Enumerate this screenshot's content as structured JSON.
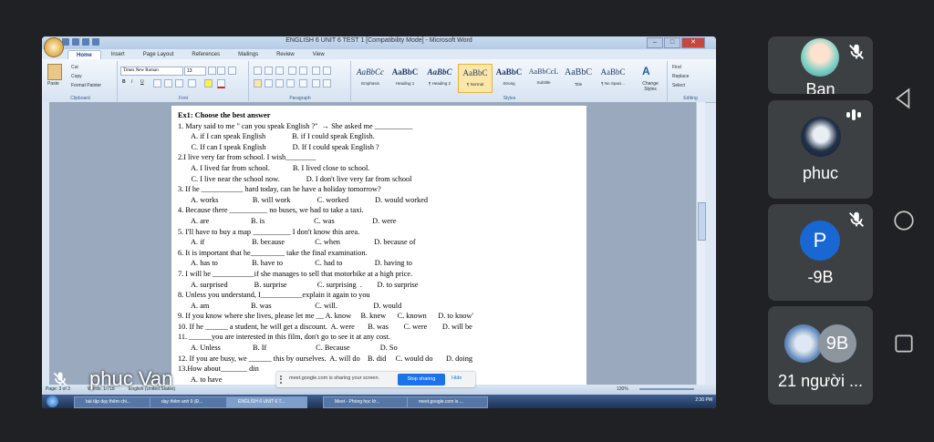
{
  "word": {
    "window_title": "ENGLISH 6 UNIT 6 TEST 1 [Compatibility Mode] - Microsoft Word",
    "tabs": [
      "Home",
      "Insert",
      "Page Layout",
      "References",
      "Mailings",
      "Review",
      "View"
    ],
    "clipboard": {
      "paste": "Paste",
      "cut": "Cut",
      "copy": "Copy",
      "format_painter": "Format Painter",
      "label": "Clipboard"
    },
    "font": {
      "name": "Times New Roman",
      "size": "13",
      "label": "Font"
    },
    "paragraph_label": "Paragraph",
    "styles_label": "Styles",
    "styles": [
      {
        "sample": "AaBbCc",
        "name": "Emphasis"
      },
      {
        "sample": "AaBbC",
        "name": "Heading 1"
      },
      {
        "sample": "AaBbC",
        "name": "¶ Heading 2"
      },
      {
        "sample": "AaBbC",
        "name": "¶ Normal"
      },
      {
        "sample": "AaBbC",
        "name": "Strong"
      },
      {
        "sample": "AaBbCcL",
        "name": "Subtitle"
      },
      {
        "sample": "AaBbC",
        "name": "Title"
      },
      {
        "sample": "AaBbC",
        "name": "¶ No Spaci..."
      }
    ],
    "change_styles": "Change Styles",
    "editing": {
      "find": "Find",
      "replace": "Replace",
      "select": "Select",
      "label": "Editing"
    },
    "document_lines": [
      "Ex1: Choose the best answer",
      "1. Mary said to me \" can you speak English ?\"  → She asked me __________",
      "       A. if I can speak English              B. if I could speak English.",
      "       C. If can I speak English              D. If I could speak English ?",
      "2.I live very far from school. I wish________",
      "       A. I lived far from school.            B. I lived close to school.",
      "       C. I live near the school now.              D. I don't live very far from school",
      "3. If he ___________ hard today, can he have a holiday tomorrow?",
      "       A. works                  B. will work              C. worked              D. would worked",
      "4. Because there __________ no buses, we had to take a taxi.",
      "       A. are                      B. is                          C. was                    D. were",
      "5. I'll have to buy a map __________ I don't know this area.",
      "       A. if                         B. because                C. when                  D. because of",
      "6. It is important that he_________ take the final examination.",
      "       A. has to                  B. have to                 C. had to                 D. having to",
      "7. I will be ___________if she manages to sell that motorbike at a high price.",
      "       A. surprised              B. surprise                C. surprising  .        D. to surprise",
      "8. Unless you understand, I___________explain it again to you",
      "       A. am                      B. was                       C. will.                   D. would",
      "9. If you know where she lives, please let me __ A. know     B. knew      C. known      D. to know'",
      "10. If he ______ a student, he will get a discount.  A. were       B. was        C. were        D. will be",
      "11. ______you are interested in this film, don't go to see it at any cost.",
      "       A. Unless                 B. If                          C. Because                D. So",
      "12. If you are busy, we ______ this by ourselves.  A. will do    B. did     C. would do       D. doing",
      "13.How about_______ din",
      "       A. to have                                                                                       D. having"
    ],
    "status": {
      "page": "Page: 3 of 3",
      "words": "Words: 1/718",
      "lang": "English (United States)",
      "zoom": "130%"
    },
    "taskbar": [
      "bài tập dạy thêm chi...",
      "dạy thêm anh 9 (Đ...",
      "ENGLISH 6 UNIT 6 T...",
      "Meet - Phòng học lớ...",
      "meet.google.com is ..."
    ],
    "clock": "2:30 PM"
  },
  "share_bar": {
    "text": "meet.google.com is sharing your screen.",
    "stop": "Stop sharing",
    "hide": "Hide"
  },
  "presenter": {
    "name": "phuc Van"
  },
  "participants": [
    {
      "name": "Ban",
      "avatar": "anime-avatar",
      "muted": true
    },
    {
      "name": "phuc",
      "avatar": "penguin-avatar",
      "speaking": true
    },
    {
      "name": "-9B",
      "initial": "P",
      "muted": true,
      "color": "#1967d2"
    },
    {
      "name": "21 người ...",
      "badge": "9B"
    }
  ],
  "colors": {
    "meet_bg": "#202124",
    "tile_bg": "#3c4043",
    "accent": "#1a73e8"
  }
}
